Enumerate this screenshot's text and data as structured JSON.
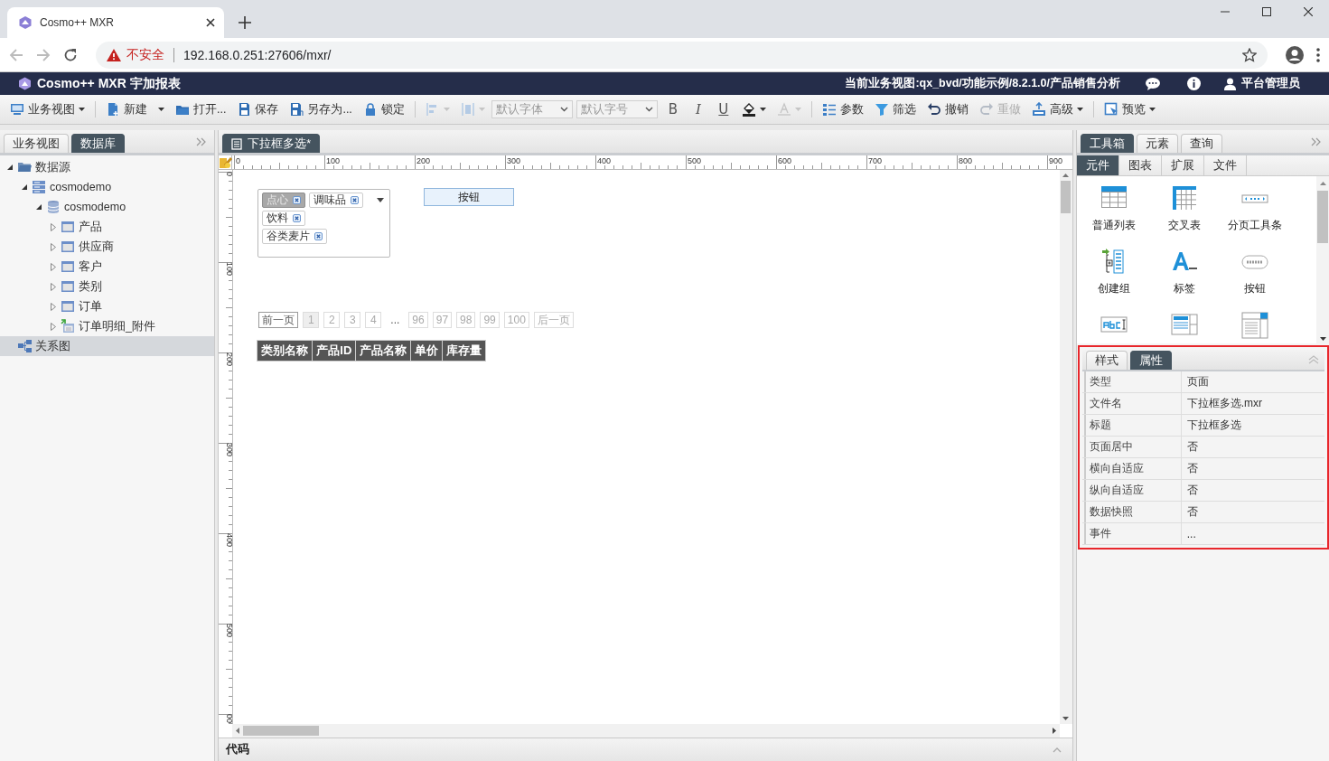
{
  "browser": {
    "tab_title": "Cosmo++ MXR",
    "security_label": "不安全",
    "url": "192.168.0.251:27606/mxr/"
  },
  "app_header": {
    "title": "Cosmo++ MXR 宇加报表",
    "current_view": "当前业务视图:qx_bvd/功能示例/8.2.1.0/产品销售分析",
    "user": "平台管理员"
  },
  "toolbar": [
    {
      "kind": "button",
      "label": "业务视图",
      "dropdown": true,
      "disabled": false
    },
    {
      "kind": "separator"
    },
    {
      "kind": "button",
      "label": "新建",
      "dropdown": true,
      "disabled": false
    },
    {
      "kind": "button",
      "label": "打开...",
      "dropdown": false,
      "disabled": false
    },
    {
      "kind": "button",
      "label": "保存",
      "dropdown": false,
      "disabled": false
    },
    {
      "kind": "button",
      "label": "另存为...",
      "dropdown": false,
      "disabled": false
    },
    {
      "kind": "button",
      "label": "锁定",
      "dropdown": false,
      "disabled": false
    },
    {
      "kind": "separator"
    },
    {
      "kind": "button",
      "dropdown": true,
      "disabled": true
    },
    {
      "kind": "button",
      "dropdown": true,
      "disabled": true
    },
    {
      "kind": "select",
      "placeholder": "默认字体"
    },
    {
      "kind": "select",
      "placeholder": "默认字号"
    },
    {
      "kind": "bold",
      "label": "B"
    },
    {
      "kind": "italic",
      "label": "I"
    },
    {
      "kind": "underline",
      "label": "U"
    },
    {
      "kind": "button",
      "dropdown": true,
      "disabled": false
    },
    {
      "kind": "button",
      "dropdown": true,
      "disabled": true
    },
    {
      "kind": "separator"
    },
    {
      "kind": "button",
      "label": "参数",
      "dropdown": false,
      "disabled": false
    },
    {
      "kind": "button",
      "label": "筛选",
      "dropdown": false,
      "disabled": false
    },
    {
      "kind": "button",
      "label": "撤销",
      "dropdown": false,
      "disabled": false
    },
    {
      "kind": "button",
      "label": "重做",
      "dropdown": false,
      "disabled": true
    },
    {
      "kind": "button",
      "label": "高级",
      "dropdown": true,
      "disabled": false
    },
    {
      "kind": "separator"
    },
    {
      "kind": "button",
      "label": "预览",
      "dropdown": true,
      "disabled": false
    }
  ],
  "left_panel": {
    "tabs": [
      {
        "label": "业务视图",
        "selected": false
      },
      {
        "label": "数据库",
        "selected": true
      }
    ],
    "tree": [
      {
        "label": "数据源",
        "kind": "folder",
        "expanded": true,
        "selected": false,
        "children": [
          {
            "label": "cosmodemo",
            "kind": "server",
            "expanded": true,
            "selected": false,
            "children": [
              {
                "label": "cosmodemo",
                "kind": "database",
                "expanded": true,
                "selected": false,
                "children": [
                  {
                    "label": "产品",
                    "kind": "table",
                    "expanded": false,
                    "selected": false
                  },
                  {
                    "label": "供应商",
                    "kind": "table",
                    "expanded": false,
                    "selected": false
                  },
                  {
                    "label": "客户",
                    "kind": "table",
                    "expanded": false,
                    "selected": false
                  },
                  {
                    "label": "类别",
                    "kind": "table",
                    "expanded": false,
                    "selected": false
                  },
                  {
                    "label": "订单",
                    "kind": "table",
                    "expanded": false,
                    "selected": false
                  },
                  {
                    "label": "订单明细_附件",
                    "kind": "view",
                    "expanded": false,
                    "selected": false
                  }
                ]
              }
            ]
          }
        ]
      },
      {
        "label": "关系图",
        "kind": "diagram",
        "selected": true
      }
    ]
  },
  "designer": {
    "tab": {
      "label": "下拉框多选*",
      "selected": true
    },
    "ruler": {
      "x_labels": [
        "0",
        "100",
        "200",
        "300",
        "400",
        "500",
        "600",
        "700",
        "800",
        "900"
      ],
      "y_labels": [
        "0",
        "100",
        "200",
        "300",
        "400",
        "500",
        "00"
      ]
    },
    "combo": {
      "tags": [
        {
          "label": "点心",
          "selected": true
        },
        {
          "label": "调味品",
          "selected": false
        },
        {
          "label": "饮料",
          "selected": false
        },
        {
          "label": "谷类麦片",
          "selected": false
        }
      ]
    },
    "button": {
      "label": "按钮"
    },
    "pager": {
      "prev": {
        "label": "前一页",
        "disabled": false
      },
      "pages": [
        {
          "label": "1",
          "selected": true
        },
        {
          "label": "2",
          "selected": false
        },
        {
          "label": "3",
          "selected": false
        },
        {
          "label": "4",
          "selected": false
        }
      ],
      "ellipsis": "...",
      "tail_pages": [
        {
          "label": "96",
          "selected": false
        },
        {
          "label": "97",
          "selected": false
        },
        {
          "label": "98",
          "selected": false
        },
        {
          "label": "99",
          "selected": false
        },
        {
          "label": "100",
          "selected": false
        }
      ],
      "next": {
        "label": "后一页",
        "disabled": true
      }
    },
    "table": {
      "columns": [
        "类别名称",
        "产品ID",
        "产品名称",
        "单价",
        "库存量"
      ]
    },
    "code_bar": {
      "label": "代码"
    }
  },
  "right_panel": {
    "tabs": [
      {
        "label": "工具箱",
        "selected": true
      },
      {
        "label": "元素",
        "selected": false
      },
      {
        "label": "查询",
        "selected": false
      }
    ],
    "subtabs": [
      {
        "label": "元件",
        "selected": true
      },
      {
        "label": "图表",
        "selected": false
      },
      {
        "label": "扩展",
        "selected": false
      },
      {
        "label": "文件",
        "selected": false
      }
    ],
    "tools": [
      {
        "kind": "list",
        "label": "普通列表"
      },
      {
        "kind": "crosstab",
        "label": "交叉表"
      },
      {
        "kind": "pager",
        "label": "分页工具条"
      },
      {
        "kind": "group",
        "label": "创建组"
      },
      {
        "kind": "label",
        "label": "标签"
      },
      {
        "kind": "submit",
        "label": "按钮"
      },
      {
        "kind": "textbox"
      },
      {
        "kind": "textarea"
      },
      {
        "kind": "dropdown"
      }
    ],
    "properties": {
      "highlighted": true,
      "tabs": [
        {
          "label": "样式",
          "selected": false
        },
        {
          "label": "属性",
          "selected": true
        }
      ],
      "rows": [
        {
          "name": "类型",
          "value": "页面"
        },
        {
          "name": "文件名",
          "value": "下拉框多选.mxr"
        },
        {
          "name": "标题",
          "value": "下拉框多选"
        },
        {
          "name": "页面居中",
          "value": "否"
        },
        {
          "name": "横向自适应",
          "value": "否"
        },
        {
          "name": "纵向自适应",
          "value": "否"
        },
        {
          "name": "数据快照",
          "value": "否"
        },
        {
          "name": "事件",
          "value": "..."
        }
      ]
    }
  }
}
